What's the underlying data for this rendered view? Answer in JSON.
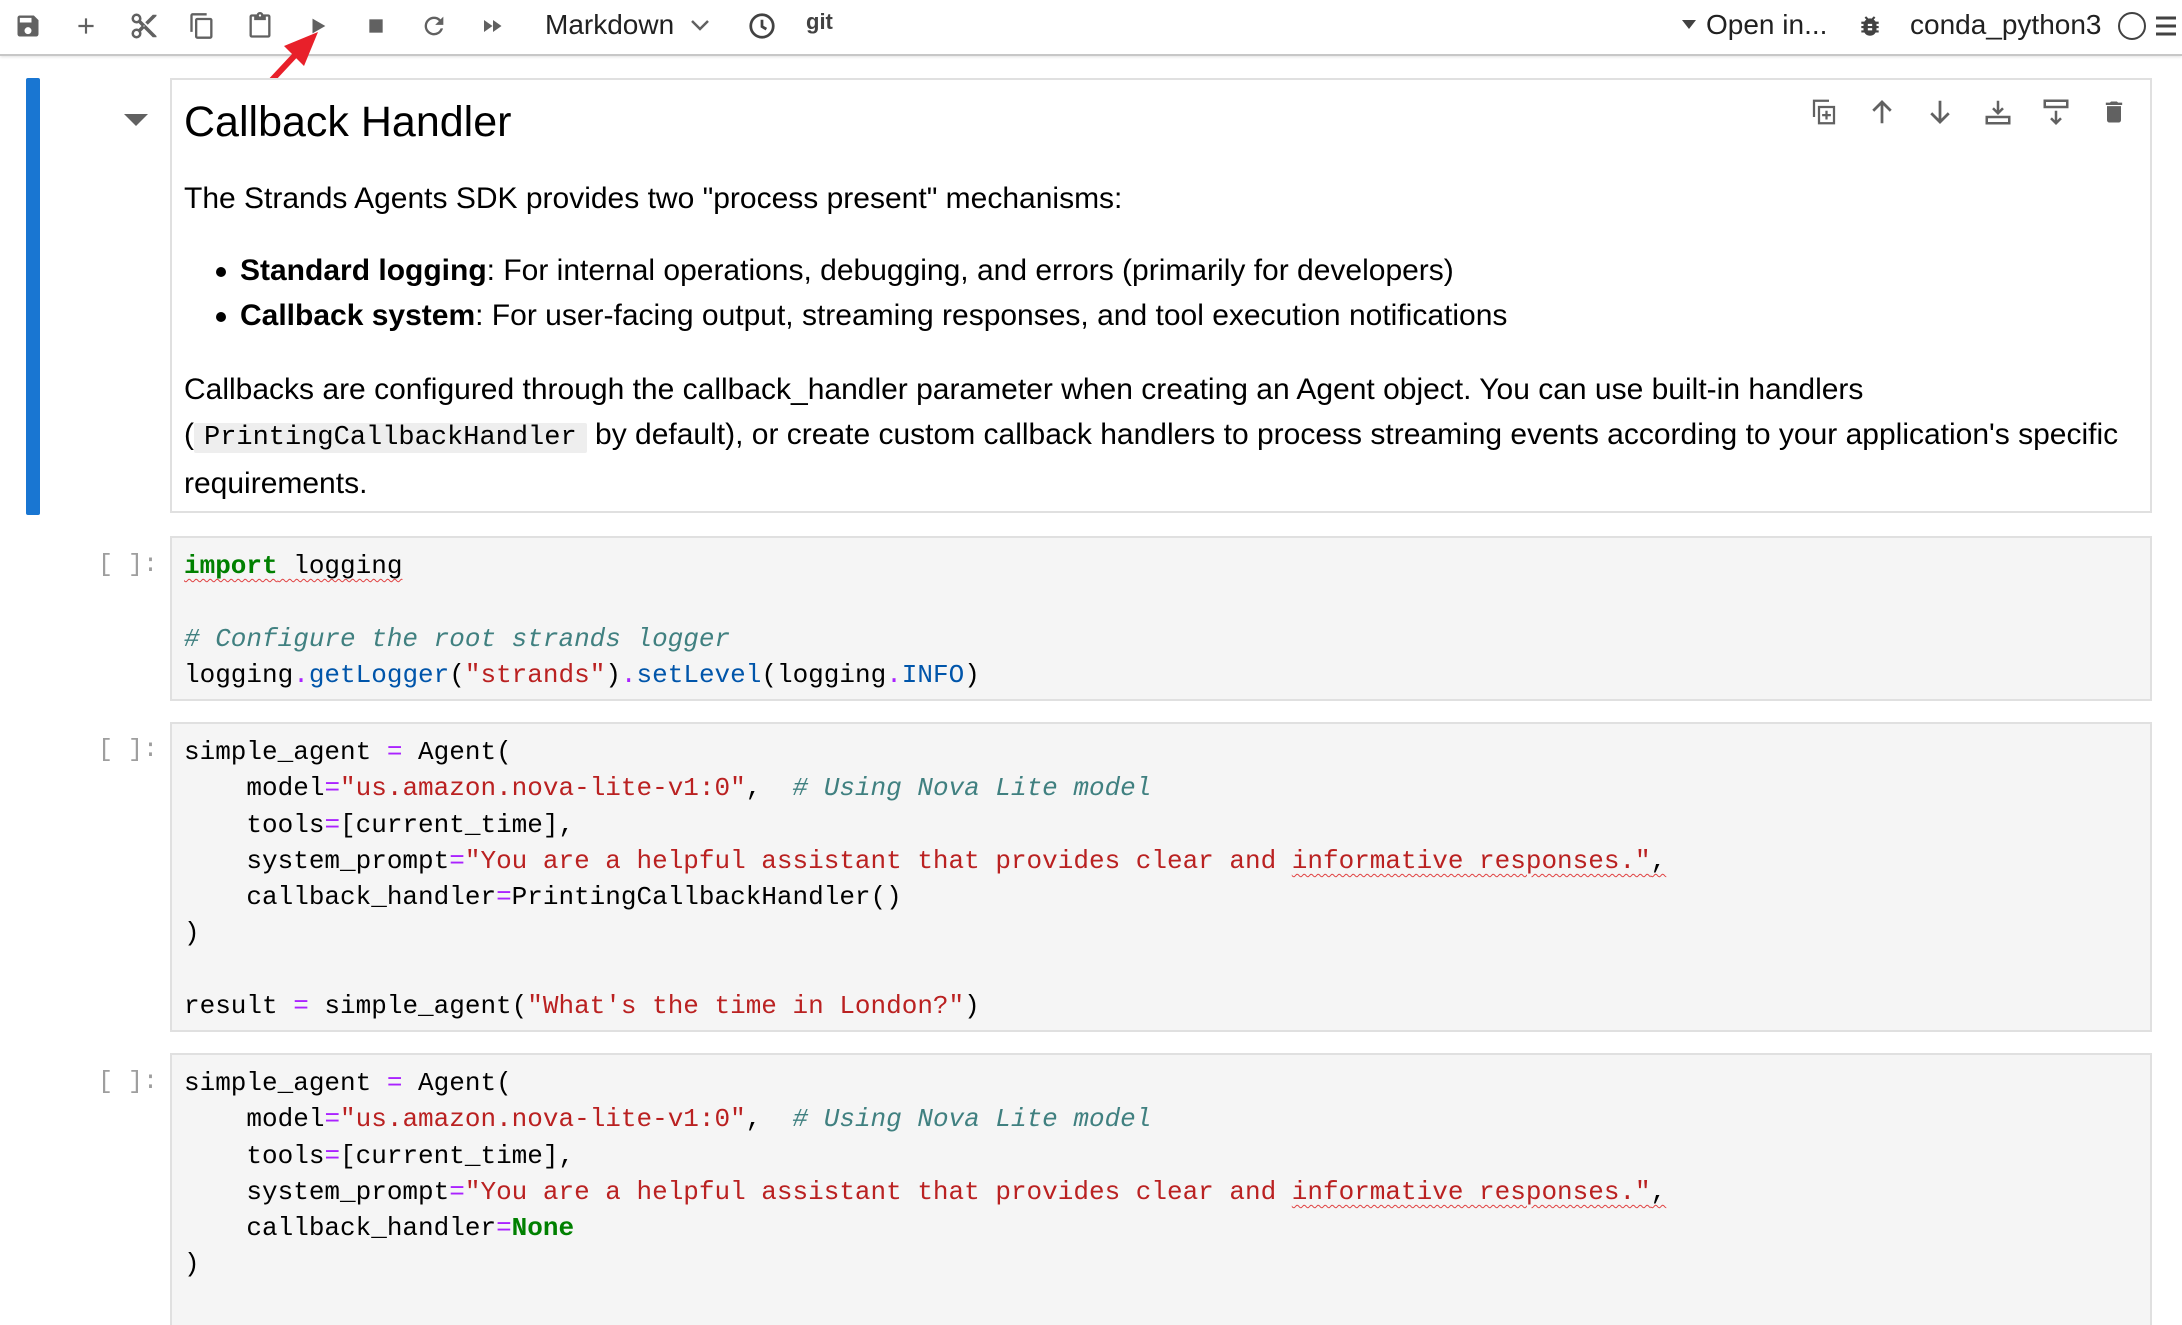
{
  "toolbar": {
    "cell_type": "Markdown",
    "git_label": "git",
    "open_in": "Open in...",
    "kernel_name": "conda_python3",
    "icons": [
      "save-icon",
      "add-icon",
      "cut-icon",
      "copy-icon",
      "paste-icon",
      "run-icon",
      "stop-icon",
      "restart-icon",
      "fast-forward-icon",
      "chevron-down-icon",
      "clock-icon",
      "bug-icon",
      "kernel-status-icon",
      "menu-icon"
    ]
  },
  "markdown_cell": {
    "title": "Callback Handler",
    "intro": "The Strands Agents SDK provides two \"process present\" mechanisms:",
    "bullets": [
      {
        "bold": "Standard logging",
        "text": ": For internal operations, debugging, and errors (primarily for developers)"
      },
      {
        "bold": "Callback system",
        "text": ": For user-facing output, streaming responses, and tool execution notifications"
      }
    ],
    "para_line1": "Callbacks are configured through the callback_handler parameter when creating an Agent object. You can use built-in handlers",
    "para_paren_open": "(",
    "para_code": "PrintingCallbackHandler",
    "para_line2_rest": " by default), or create custom callback handlers to process streaming events according to your application's specific",
    "para_line3": "requirements."
  },
  "code_cells": [
    {
      "prompt": "[ ]:"
    },
    {
      "prompt": "[ ]:"
    },
    {
      "prompt": "[ ]:"
    }
  ],
  "colors": {
    "active_cell_bar": "#1976d2",
    "annotation_arrow": "#e8202a",
    "keyword": "#008000",
    "string": "#ba2121",
    "comment": "#408080"
  }
}
